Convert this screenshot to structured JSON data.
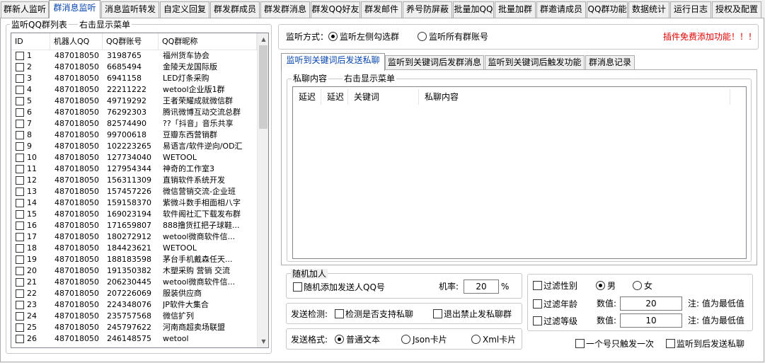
{
  "top_tabs": [
    "群新人监听",
    "群消息监听",
    "消息监听转发",
    "自定义回复",
    "群发群成员",
    "群发群消息",
    "群发QQ好友",
    "群发邮件",
    "养号防屏蔽",
    "批量加QQ",
    "批量加群",
    "群邀请成员",
    "QQ群功能",
    "数据统计",
    "运行日志",
    "授权及配置"
  ],
  "left": {
    "group_title": "监听QQ群列表",
    "hint": "右击显示菜单",
    "columns": [
      "ID",
      "机器人QQ",
      "QQ群账号",
      "QQ群昵称"
    ],
    "rows": [
      [
        "1",
        "487018050",
        "3198765",
        "福州货车协会"
      ],
      [
        "2",
        "487018050",
        "6685494",
        "金陵天龙国际版"
      ],
      [
        "3",
        "487018050",
        "6941158",
        "LED灯条采购"
      ],
      [
        "4",
        "487018050",
        "22211222",
        "wetool企业版1群"
      ],
      [
        "5",
        "487018050",
        "49719292",
        "王者荣耀成就微信群"
      ],
      [
        "6",
        "487018050",
        "76292303",
        "腾讯微博互动交流总群"
      ],
      [
        "7",
        "487018050",
        "82574490",
        "??「抖音」音乐共享"
      ],
      [
        "8",
        "487018050",
        "99700618",
        "豆瓣东西营销群"
      ],
      [
        "9",
        "487018050",
        "102223265",
        "易语言/软件逆向/OD汇"
      ],
      [
        "10",
        "487018050",
        "127734040",
        "WETOOL"
      ],
      [
        "11",
        "487018050",
        "127954344",
        "神奇的工作室3"
      ],
      [
        "12",
        "487018050",
        "156311309",
        "直销软件系统开发"
      ],
      [
        "13",
        "487018050",
        "157457226",
        "微信营销交流-企业班"
      ],
      [
        "14",
        "487018050",
        "159158370",
        "紫微斗数手相面相八字"
      ],
      [
        "15",
        "487018050",
        "169023194",
        "软件阁社汇下载发布群"
      ],
      [
        "16",
        "487018050",
        "171659807",
        "888撸货扛把子球鞋..."
      ],
      [
        "17",
        "487018050",
        "180272912",
        "wetool微商软件信..."
      ],
      [
        "18",
        "487018050",
        "184423621",
        "WETOOL"
      ],
      [
        "19",
        "487018050",
        "188183598",
        "茅台手机戴森任天..."
      ],
      [
        "20",
        "487018050",
        "191350382",
        "木塑采购 营销 交流"
      ],
      [
        "21",
        "487018050",
        "206230445",
        "wetool微商软件信..."
      ],
      [
        "22",
        "487018050",
        "207226069",
        "服装供应商"
      ],
      [
        "23",
        "487018050",
        "224348076",
        "JP软件大集合"
      ],
      [
        "24",
        "487018050",
        "235757568",
        "微信扩列"
      ],
      [
        "25",
        "487018050",
        "245797622",
        "河南商超卖场联盟"
      ],
      [
        "26",
        "487018050",
        "246148575",
        "wetool"
      ]
    ],
    "scroll_up": "▲",
    "scroll_down": "▼"
  },
  "right": {
    "mode_label": "监听方式：",
    "mode_option1": "监听左侧勾选群",
    "mode_option2": "监听所有群账号",
    "promo": "插件免费添加功能！！！",
    "inner_tabs": [
      "监听到关键词后发送私聊",
      "监听到关键词后发群消息",
      "监听到关键词后触发功能",
      "群消息记录"
    ],
    "private_content_label": "私聊内容",
    "private_hint": "右击显示菜单",
    "kw_columns": [
      "延迟",
      "延迟",
      "关键词",
      "私聊内容"
    ],
    "random_add_title": "随机加人",
    "random_add_cb": "随机添加发送人QQ号",
    "rate_label": "机率:",
    "rate_value": "20",
    "rate_unit": "%",
    "send_check_label": "发送检测:",
    "check_support": "检测是否支持私聊",
    "exit_forbid": "退出禁止发私聊群",
    "format_label": "发送格式:",
    "format_text": "普通文本",
    "format_json": "Json卡片",
    "format_xml": "Xml卡片",
    "filter_gender": "过滤性别",
    "male": "男",
    "female": "女",
    "filter_age": "过滤年龄",
    "filter_level": "过滤等级",
    "value_label": "数值:",
    "age_value": "20",
    "level_value": "10",
    "note": "注: 值为最低值",
    "once_per_qq": "一个号只触发一次",
    "send_after_listen": "监听到后发送私聊"
  }
}
